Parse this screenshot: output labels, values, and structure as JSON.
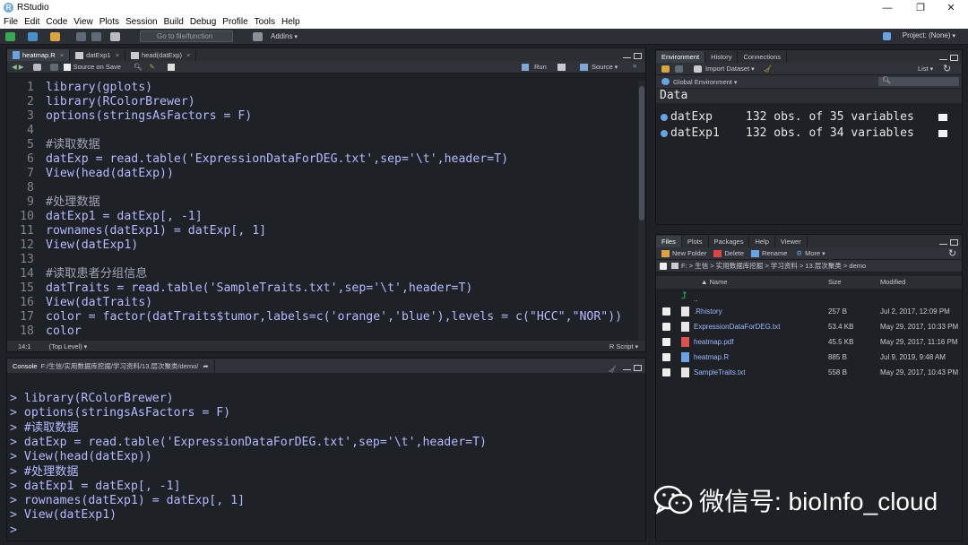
{
  "window": {
    "title": "RStudio",
    "logo_letter": "R"
  },
  "menu": [
    "File",
    "Edit",
    "Code",
    "View",
    "Plots",
    "Session",
    "Build",
    "Debug",
    "Profile",
    "Tools",
    "Help"
  ],
  "toolbar": {
    "goto_placeholder": "Go to file/function",
    "addins": "Addins",
    "project": "Project: (None)"
  },
  "editor": {
    "tabs": [
      "heatmap.R",
      "datExp1",
      "head(datExp)"
    ],
    "source_on_save": "Source on Save",
    "run": "Run",
    "source": "Source",
    "lines": [
      {
        "n": "1",
        "t": "library(gplots)"
      },
      {
        "n": "2",
        "t": "library(RColorBrewer)"
      },
      {
        "n": "3",
        "t": "options(stringsAsFactors = F)"
      },
      {
        "n": "4",
        "t": ""
      },
      {
        "n": "5",
        "t": "#读取数据"
      },
      {
        "n": "6",
        "t": "datExp = read.table('ExpressionDataForDEG.txt',sep='\\t',header=T)"
      },
      {
        "n": "7",
        "t": "View(head(datExp))"
      },
      {
        "n": "8",
        "t": ""
      },
      {
        "n": "9",
        "t": "#处理数据"
      },
      {
        "n": "10",
        "t": "datExp1 = datExp[, -1]"
      },
      {
        "n": "11",
        "t": "rownames(datExp1) = datExp[, 1]"
      },
      {
        "n": "12",
        "t": "View(datExp1)"
      },
      {
        "n": "13",
        "t": ""
      },
      {
        "n": "14",
        "t": "#读取患者分组信息"
      },
      {
        "n": "15",
        "t": "datTraits = read.table('SampleTraits.txt',sep='\\t',header=T)"
      },
      {
        "n": "16",
        "t": "View(datTraits)"
      },
      {
        "n": "17",
        "t": "color = factor(datTraits$tumor,labels=c('orange','blue'),levels = c(\"HCC\",\"NOR\"))"
      },
      {
        "n": "18",
        "t": "color"
      }
    ],
    "status_pos": "14:1",
    "status_scope": "(Top Level)",
    "status_type": "R Script"
  },
  "console": {
    "tab": "Console",
    "path": "F:/生信/实用数据库挖掘/学习资料/13.层次聚类/demo/",
    "lines": [
      "> library(RColorBrewer)",
      "> options(stringsAsFactors = F)",
      "> #读取数据",
      "> datExp = read.table('ExpressionDataForDEG.txt',sep='\\t',header=T)",
      "> View(head(datExp))",
      "> #处理数据",
      "> datExp1 = datExp[, -1]",
      "> rownames(datExp1) = datExp[, 1]",
      "> View(datExp1)",
      "> "
    ]
  },
  "environment": {
    "tabs": [
      "Environment",
      "History",
      "Connections"
    ],
    "import_dataset": "Import Dataset",
    "list": "List",
    "scope": "Global Environment",
    "section": "Data",
    "rows": [
      {
        "name": "datExp",
        "value": "132 obs. of 35 variables"
      },
      {
        "name": "datExp1",
        "value": "132 obs. of 34 variables"
      }
    ]
  },
  "files": {
    "tabs": [
      "Files",
      "Plots",
      "Packages",
      "Help",
      "Viewer"
    ],
    "new_folder": "New Folder",
    "delete": "Delete",
    "rename": "Rename",
    "more": "More",
    "path": [
      "F:",
      "生信",
      "实用数据库挖掘",
      "学习资料",
      "13.层次聚类",
      "demo"
    ],
    "columns": {
      "name": "Name",
      "size": "Size",
      "modified": "Modified"
    },
    "up": "..",
    "rows": [
      {
        "name": ".Rhistory",
        "size": "257 B",
        "modified": "Jul 2, 2017, 12:09 PM",
        "kind": "doc"
      },
      {
        "name": "ExpressionDataForDEG.txt",
        "size": "53.4 KB",
        "modified": "May 29, 2017, 10:33 PM",
        "kind": "doc"
      },
      {
        "name": "heatmap.pdf",
        "size": "45.5 KB",
        "modified": "May 29, 2017, 11:16 PM",
        "kind": "pdf"
      },
      {
        "name": "heatmap.R",
        "size": "885 B",
        "modified": "Jul 9, 2019, 9:48 AM",
        "kind": "r"
      },
      {
        "name": "SampleTraits.txt",
        "size": "558 B",
        "modified": "May 29, 2017, 10:43 PM",
        "kind": "doc"
      }
    ]
  },
  "watermark": "微信号: bioInfo_cloud"
}
